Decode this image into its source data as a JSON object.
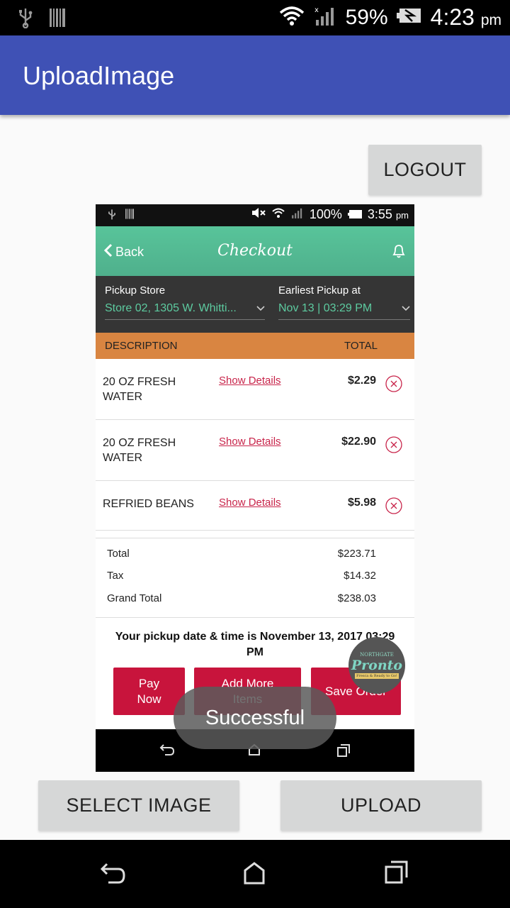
{
  "status_bar": {
    "battery": "59%",
    "time": "4:23",
    "ampm": "pm"
  },
  "app_bar": {
    "title": "UploadImage"
  },
  "buttons": {
    "logout": "LOGOUT",
    "select_image": "SELECT IMAGE",
    "upload": "UPLOAD"
  },
  "toast": "Successful",
  "preview": {
    "status": {
      "battery": "100%",
      "time": "3:55",
      "ampm": "pm"
    },
    "header": {
      "back": "Back",
      "title": "Checkout"
    },
    "pickup": {
      "store_label": "Pickup Store",
      "store_value": "Store 02, 1305 W. Whitti...",
      "time_label": "Earliest Pickup at",
      "time_value": "Nov 13  | 03:29 PM"
    },
    "table_head": {
      "description": "DESCRIPTION",
      "total": "TOTAL"
    },
    "items": [
      {
        "name": "20 OZ FRESH WATER",
        "details": "Show Details",
        "price": "$2.29"
      },
      {
        "name": "20 OZ FRESH WATER",
        "details": "Show Details",
        "price": "$22.90"
      },
      {
        "name": "REFRIED BEANS",
        "details": "Show Details",
        "price": "$5.98"
      }
    ],
    "totals": [
      {
        "label": "Total",
        "value": "$223.71"
      },
      {
        "label": "Tax",
        "value": "$14.32"
      },
      {
        "label": "Grand Total",
        "value": "$238.03"
      }
    ],
    "pickup_msg": "Your pickup date & time is November 13, 2017 03:29 PM",
    "actions": {
      "pay": "Pay Now",
      "add": "Add More Items",
      "save": "Save Order"
    },
    "logo": {
      "top": "NORTHGATE",
      "main": "Pronto",
      "tag": "Fresca & Ready to Go!"
    }
  }
}
